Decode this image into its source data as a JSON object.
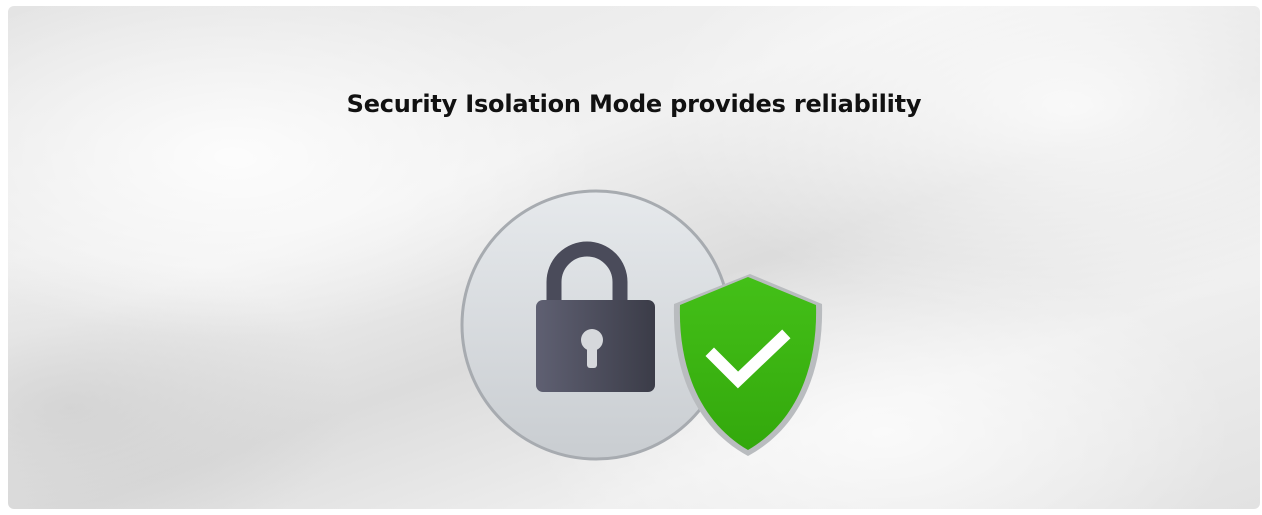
{
  "banner": {
    "title": "Security Isolation Mode provides reliability",
    "icons": {
      "lock": "padlock-icon",
      "shield": "shield-check-icon"
    },
    "colors": {
      "shield_green": "#3db612",
      "lock_dark": "#4a4b5a",
      "circle_light": "#dfe2e5"
    }
  }
}
